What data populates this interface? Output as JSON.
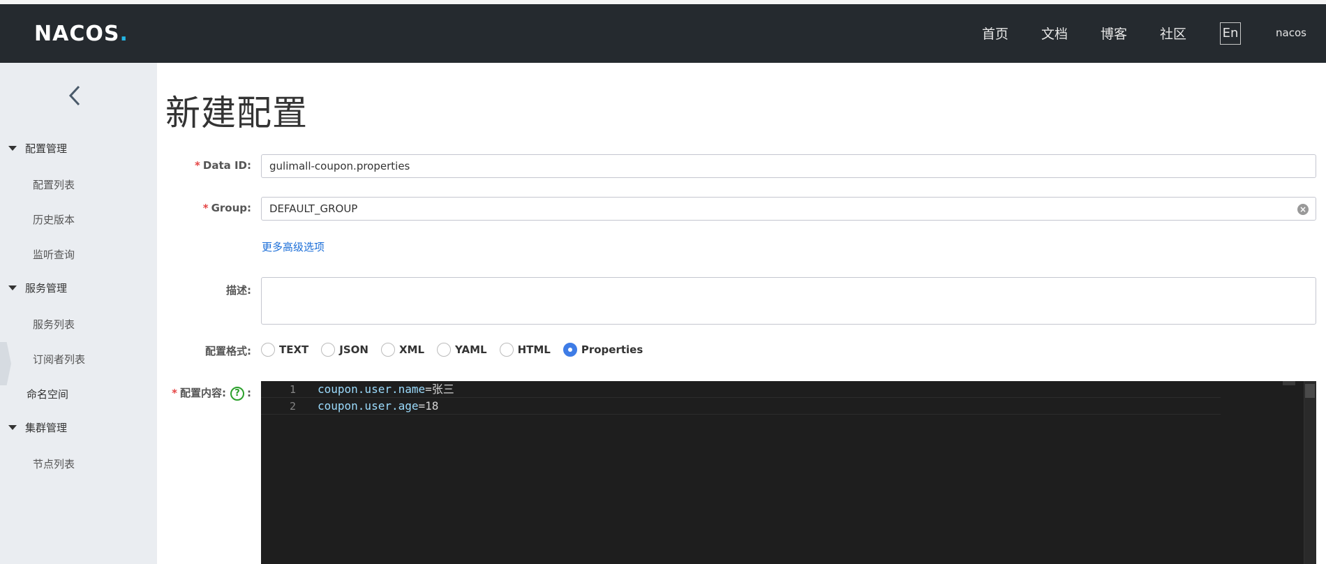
{
  "header": {
    "logo_text": "NACOS",
    "logo_dot": ".",
    "nav": [
      "首页",
      "文档",
      "博客",
      "社区"
    ],
    "lang": "En",
    "user": "nacos"
  },
  "sidebar": {
    "groups": [
      {
        "label": "配置管理",
        "items": [
          "配置列表",
          "历史版本",
          "监听查询"
        ]
      },
      {
        "label": "服务管理",
        "items": [
          "服务列表",
          "订阅者列表"
        ]
      }
    ],
    "namespace": "命名空间",
    "cluster": {
      "label": "集群管理",
      "items": [
        "节点列表"
      ]
    }
  },
  "page": {
    "title": "新建配置"
  },
  "form": {
    "data_id_label": "Data ID:",
    "data_id_value": "gulimall-coupon.properties",
    "group_label": "Group:",
    "group_value": "DEFAULT_GROUP",
    "advanced_link": "更多高级选项",
    "desc_label": "描述:",
    "desc_value": "",
    "format_label": "配置格式:",
    "formats": [
      "TEXT",
      "JSON",
      "XML",
      "YAML",
      "HTML",
      "Properties"
    ],
    "selected_format": "Properties",
    "content_label": "配置内容:",
    "content_colon": ":",
    "help_icon_glyph": "?",
    "required_mark": "*"
  },
  "editor": {
    "lines": [
      {
        "num": "1",
        "key": "coupon.user.name",
        "eq": "=",
        "value": "张三"
      },
      {
        "num": "2",
        "key": "coupon.user.age",
        "eq": "=",
        "value": "18"
      }
    ]
  },
  "colors": {
    "topbar": "#252a2f",
    "sidebar": "#eaedf1",
    "accent": "#3e7ce6",
    "link": "#1b6ed8",
    "required": "#e54545",
    "editor_bg": "#1e1e1e"
  }
}
